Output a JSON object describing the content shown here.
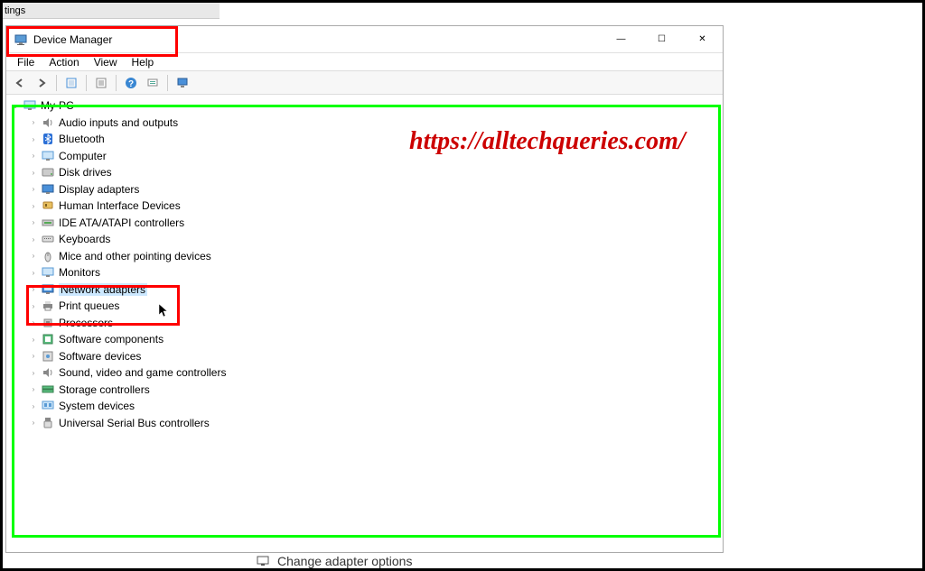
{
  "background_window": {
    "title_fragment": "tings"
  },
  "window": {
    "title": "Device Manager",
    "controls": {
      "minimize": "—",
      "maximize": "☐",
      "close": "✕"
    }
  },
  "menu": {
    "file": "File",
    "action": "Action",
    "view": "View",
    "help": "Help"
  },
  "toolbar_icons": {
    "back": "back-arrow-icon",
    "forward": "forward-arrow-icon",
    "show_hidden": "show-hidden-icon",
    "properties": "properties-icon",
    "help": "help-icon",
    "scan": "scan-icon",
    "monitor": "monitor-icon"
  },
  "tree": {
    "root": "My-PC",
    "children": [
      {
        "label": "Audio inputs and outputs",
        "icon": "audio-icon"
      },
      {
        "label": "Bluetooth",
        "icon": "bluetooth-icon"
      },
      {
        "label": "Computer",
        "icon": "computer-icon"
      },
      {
        "label": "Disk drives",
        "icon": "disk-icon"
      },
      {
        "label": "Display adapters",
        "icon": "display-icon"
      },
      {
        "label": "Human Interface Devices",
        "icon": "hid-icon"
      },
      {
        "label": "IDE ATA/ATAPI controllers",
        "icon": "ide-icon"
      },
      {
        "label": "Keyboards",
        "icon": "keyboard-icon"
      },
      {
        "label": "Mice and other pointing devices",
        "icon": "mouse-icon"
      },
      {
        "label": "Monitors",
        "icon": "monitor-icon"
      },
      {
        "label": "Network adapters",
        "icon": "network-icon",
        "highlighted": true
      },
      {
        "label": "Print queues",
        "icon": "printer-icon"
      },
      {
        "label": "Processors",
        "icon": "cpu-icon"
      },
      {
        "label": "Software components",
        "icon": "sw-comp-icon"
      },
      {
        "label": "Software devices",
        "icon": "sw-dev-icon"
      },
      {
        "label": "Sound, video and game controllers",
        "icon": "sound-icon"
      },
      {
        "label": "Storage controllers",
        "icon": "storage-icon"
      },
      {
        "label": "System devices",
        "icon": "system-icon"
      },
      {
        "label": "Universal Serial Bus controllers",
        "icon": "usb-icon"
      }
    ]
  },
  "watermark": "https://alltechqueries.com/",
  "bottom_fragment": "Change adapter options",
  "annotations": {
    "red_box_title": "device-manager-title-highlight",
    "red_box_network": "network-adapters-highlight",
    "green_box": "tree-area-highlight"
  }
}
